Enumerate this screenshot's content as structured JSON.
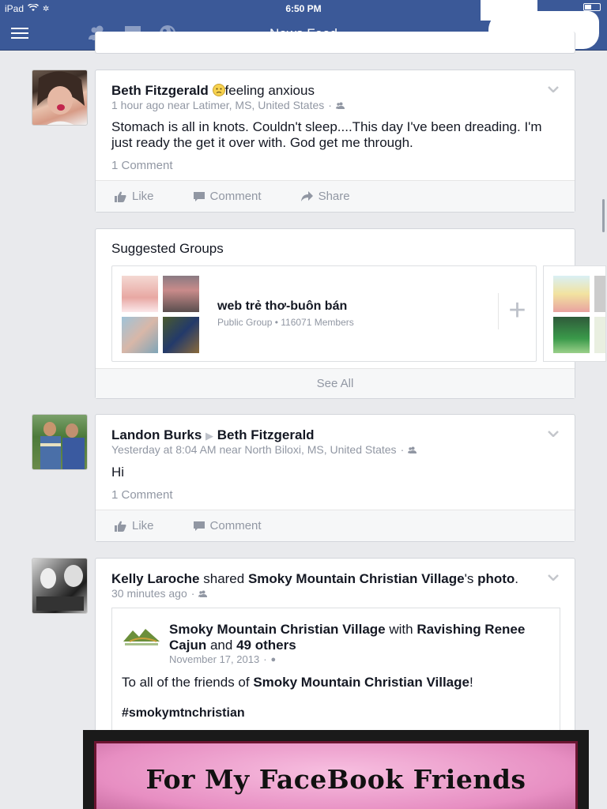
{
  "status": {
    "device": "iPad",
    "time": "6:50 PM"
  },
  "nav": {
    "title": "News Feed"
  },
  "posts": [
    {
      "author": "Beth Fitzgerald",
      "feeling": "feeling anxious",
      "meta": "1 hour ago near Latimer, MS, United States",
      "text": "Stomach is all in knots. Couldn't sleep....This day I've been dreading. I'm just ready the get it over with. God get me through.",
      "comments": "1 Comment",
      "actions": [
        "Like",
        "Comment",
        "Share"
      ]
    },
    {
      "author": "Landon Burks",
      "target": "Beth Fitzgerald",
      "meta": "Yesterday at 8:04 AM near North Biloxi, MS, United States",
      "text": "Hi",
      "comments": "1 Comment",
      "actions": [
        "Like",
        "Comment"
      ]
    },
    {
      "author": "Kelly Laroche",
      "shared_word": "shared",
      "page": "Smoky Mountain Christian Village",
      "page_suffix": "'s",
      "object": "photo",
      "period": ".",
      "meta": "30 minutes ago",
      "shared": {
        "page": "Smoky Mountain Christian Village",
        "with": "with",
        "person": "Ravishing Renee Cajun",
        "and": "and",
        "others": "49 others",
        "date": "November 17, 2013",
        "text_prefix": "To all of the friends of",
        "text_page": "Smoky Mountain Christian Village",
        "text_suffix": "!",
        "hashtag": "#smokymtnchristian"
      },
      "poster_line1": "For My FaceBook Friends"
    }
  ],
  "suggested": {
    "title": "Suggested Groups",
    "group_name": "web trẻ thơ-buôn bán",
    "group_meta": "Public Group • 116071 Members",
    "see_all": "See All"
  }
}
